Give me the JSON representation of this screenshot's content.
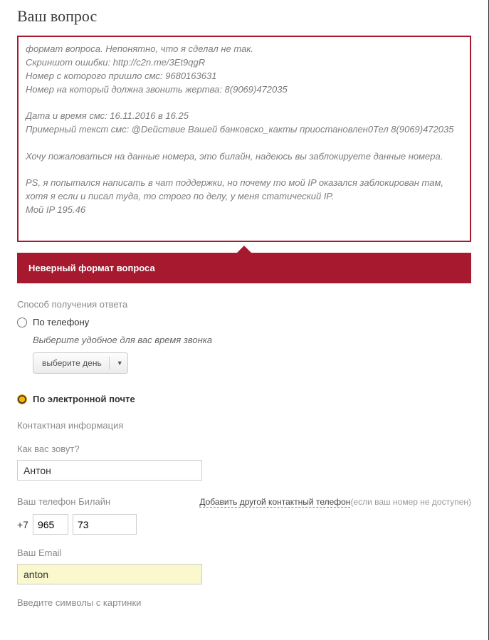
{
  "title": "Ваш вопрос",
  "question_text": "формат вопроса. Непонятно, что я сделал не так.\nСкриншот ошибки: http://c2n.me/3Et9qgR\nНомер с которого пришло смс: 9680163631\nНомер на который должна звонить жертва: 8(9069)472035\n\nДата и время смс: 16.11.2016 в 16.25\nПримерный текст смс: @Dействие Вашей банковско_какты приостановлен0Тел 8(9069)472035\n\nХочу пожаловаться на данные номера, это билайн, надеюсь вы заблокируете данные номера.\n\nPS, я попытался написать в чат поддержки, но почему то мой IP оказался заблокирован там, хотя я если и писал туда, то строго по делу, у меня статический IP.\nМой IP 195.46",
  "error_text": "Неверный формат вопроса",
  "reply_method_label": "Способ получения ответа",
  "radio_phone": "По телефону",
  "phone_hint": "Выберите удобное для вас время звонка",
  "day_select": "выберите день",
  "radio_email": "По электронной почте",
  "contact_section": "Контактная информация",
  "name_label": "Как вас зовут?",
  "name_value": "Антон",
  "phone_label": "Ваш телефон Билайн",
  "add_phone_link": "Добавить другой контактный телефон",
  "add_phone_suffix": "(если ваш номер не доступен)",
  "phone_prefix": "+7",
  "phone_code": "965",
  "phone_num": "73",
  "email_label": "Ваш Email",
  "email_value": "anton",
  "captcha_label": "Введите символы с картинки"
}
